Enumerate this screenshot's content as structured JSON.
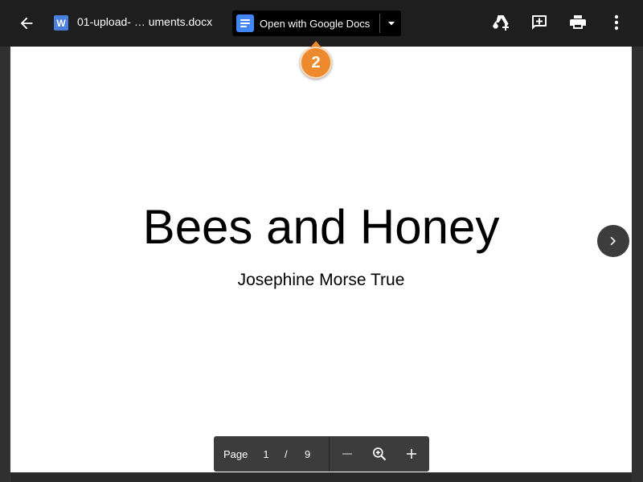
{
  "header": {
    "file_name": "01-upload- … uments.docx",
    "file_type_letter": "W",
    "open_with_label": "Open with Google Docs",
    "icons": [
      "back-arrow-icon",
      "word-file-icon",
      "google-docs-icon",
      "dropdown-caret-icon",
      "add-to-drive-icon",
      "add-comment-icon",
      "print-icon",
      "more-vert-icon"
    ]
  },
  "step_badge": {
    "number": "2",
    "color": "#ee8a2e"
  },
  "document": {
    "title": "Bees and Honey",
    "author": "Josephine Morse True"
  },
  "pager": {
    "label": "Page",
    "current": "1",
    "separator": "/",
    "total": "9"
  },
  "colors": {
    "docs_blue": "#4285f4",
    "word_blue": "#4a7fe0",
    "toolbar_bg": "#1e1e1e"
  }
}
